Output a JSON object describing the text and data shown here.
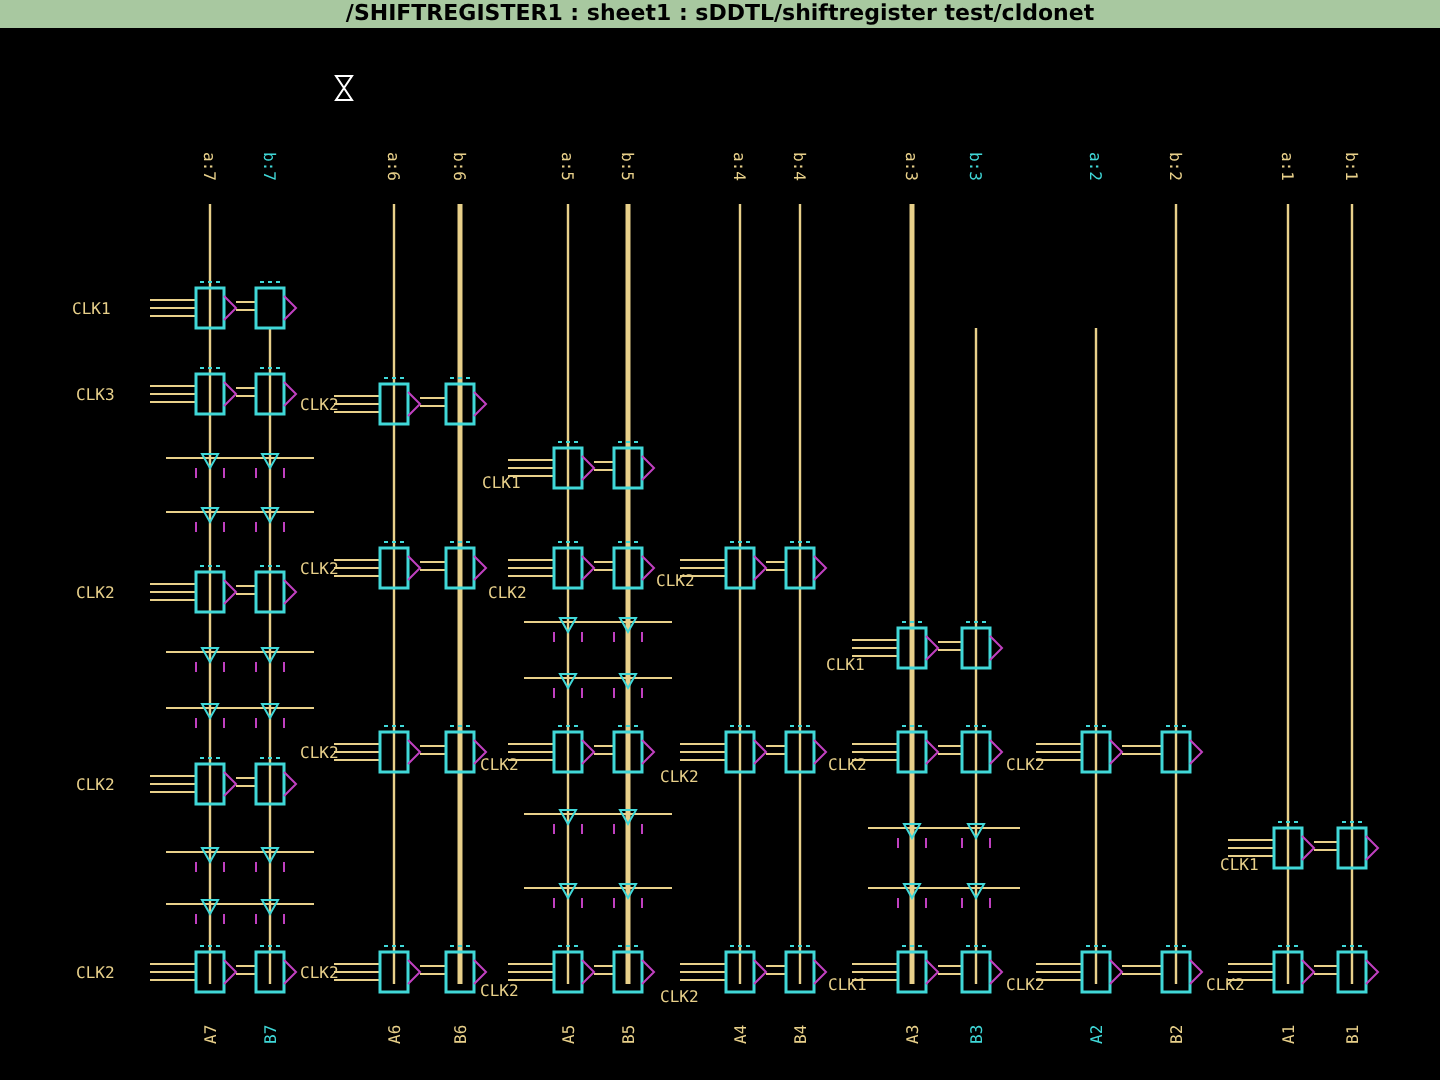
{
  "window": {
    "title": "/SHIFTREGISTER1 : sheet1 : sDDTL/shiftregister test/cldonet"
  },
  "buses": [
    {
      "top_label": "a:7",
      "bottom_label": "A7",
      "kind": "thin"
    },
    {
      "top_label": "b:7",
      "bottom_label": "B7",
      "kind": "stub"
    },
    {
      "top_label": "a:6",
      "bottom_label": "A6",
      "kind": "thin"
    },
    {
      "top_label": "b:6",
      "bottom_label": "B6",
      "kind": "thick"
    },
    {
      "top_label": "a:5",
      "bottom_label": "A5",
      "kind": "thin"
    },
    {
      "top_label": "b:5",
      "bottom_label": "B5",
      "kind": "thick"
    },
    {
      "top_label": "a:4",
      "bottom_label": "A4",
      "kind": "thin"
    },
    {
      "top_label": "b:4",
      "bottom_label": "B4",
      "kind": "thin"
    },
    {
      "top_label": "a:3",
      "bottom_label": "A3",
      "kind": "thick"
    },
    {
      "top_label": "b:3",
      "bottom_label": "B3",
      "kind": "stub"
    },
    {
      "top_label": "a:2",
      "bottom_label": "A2",
      "kind": "stub"
    },
    {
      "top_label": "b:2",
      "bottom_label": "B2",
      "kind": "thin"
    },
    {
      "top_label": "a:1",
      "bottom_label": "A1",
      "kind": "thin"
    },
    {
      "top_label": "b:1",
      "bottom_label": "B1",
      "kind": "thin"
    }
  ],
  "clock_labels": [
    "CLK1",
    "CLK3",
    "CLK2",
    "CLK2",
    "CLK2",
    "CLK2",
    "CLK2",
    "CLK2",
    "CLK2",
    "CLK1",
    "CLK2",
    "CLK2",
    "CLK2",
    "CLK2",
    "CLK2",
    "CLK2",
    "CLK1",
    "CLK2",
    "CLK1",
    "CLK2",
    "CLK2",
    "CLK1",
    "CLK2"
  ]
}
